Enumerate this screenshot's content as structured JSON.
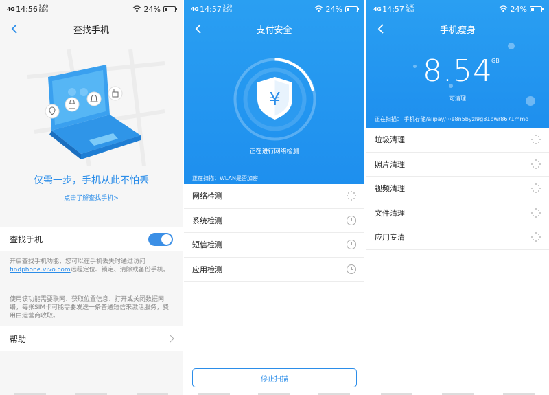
{
  "screen1": {
    "status": {
      "network": "4G",
      "time": "14:56",
      "speed": "5.60 KB/s",
      "battery": "24%"
    },
    "title": "查找手机",
    "slogan": "仅需一步，手机从此不怕丢",
    "learn_more": "点击了解查找手机>",
    "toggle": {
      "label": "查找手机",
      "on": true
    },
    "desc1_pre": "开启查找手机功能，您可以在手机丢失时通过访问",
    "desc1_link": "findphone.vivo.com",
    "desc1_post": "远程定位、锁定、清除或备份手机。",
    "desc2": "使用该功能需要联网、获取位置信息、打开或关闭数据网络，每张SIM卡可能需要发送一条普通短信来激活服务，费用由运营商收取。",
    "help": "帮助"
  },
  "screen2": {
    "status": {
      "network": "4G",
      "time": "14:57",
      "speed": "3.20 KB/s",
      "battery": "24%"
    },
    "title": "支付安全",
    "shield_symbol": "¥",
    "scanning_label": "正在进行网络检测",
    "current_scan": "正在扫描：WLAN是否加密",
    "items": [
      {
        "label": "网络检测",
        "state": "scanning"
      },
      {
        "label": "系统检测",
        "state": "pending"
      },
      {
        "label": "短信检测",
        "state": "pending"
      },
      {
        "label": "应用检测",
        "state": "pending"
      }
    ],
    "stop_button": "停止扫描"
  },
  "screen3": {
    "status": {
      "network": "4G",
      "time": "14:57",
      "speed": "2.40 KB/s",
      "battery": "24%"
    },
    "title": "手机瘦身",
    "size_value": "8.54",
    "size_unit": "GB",
    "size_caption": "可清理",
    "current_scan": "正在扫描：  手机存储/alipay/···e8n5byzl9g81bwr8671mmd",
    "items": [
      {
        "label": "垃圾清理"
      },
      {
        "label": "照片清理"
      },
      {
        "label": "视频清理"
      },
      {
        "label": "文件清理"
      },
      {
        "label": "应用专清"
      }
    ]
  },
  "colors": {
    "accent": "#2b8de9",
    "blue_header": "#1e8fee",
    "toggle_on": "#3b8fe6"
  },
  "icons": [
    "back-icon",
    "wifi-icon",
    "battery-icon",
    "location-icon",
    "lock-icon",
    "bell-icon",
    "hand-icon",
    "yen-shield-icon",
    "spinner-icon",
    "clock-icon",
    "chevron-right-icon"
  ]
}
